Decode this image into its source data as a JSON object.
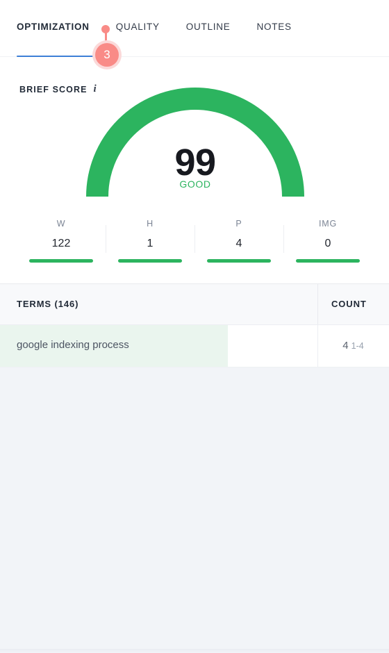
{
  "theme": {
    "accent_blue": "#3d7fd6",
    "green": "#2cb45f",
    "badge_pink": "#f98b87",
    "badge_ring": "#fbd9d9",
    "page_bg": "#f2f4f8",
    "row_highlight": "#eaf5ee"
  },
  "tabs": [
    {
      "label": "OPTIMIZATION",
      "active": true
    },
    {
      "label": "QUALITY",
      "active": false
    },
    {
      "label": "OUTLINE",
      "active": false
    },
    {
      "label": "NOTES",
      "active": false
    }
  ],
  "badge": {
    "count": "3",
    "icon": "pin-marker-icon"
  },
  "brief_score": {
    "label": "BRIEF SCORE",
    "info_icon": "i",
    "value": "99",
    "status": "GOOD"
  },
  "metrics": [
    {
      "label": "W",
      "value": "122"
    },
    {
      "label": "H",
      "value": "1"
    },
    {
      "label": "P",
      "value": "4"
    },
    {
      "label": "IMG",
      "value": "0"
    }
  ],
  "terms_table": {
    "header_terms": "TERMS (146)",
    "header_count": "COUNT",
    "rows": [
      {
        "term": "google indexing process",
        "count": "4",
        "range": "1-4"
      }
    ]
  },
  "chart_data": {
    "type": "gauge",
    "title": "BRIEF SCORE",
    "value": 99,
    "min": 0,
    "max": 100,
    "status_label": "GOOD",
    "arc_color": "#2cb45f",
    "arc_span_degrees": 180,
    "sub_metrics": {
      "type": "bar",
      "categories": [
        "W",
        "H",
        "P",
        "IMG"
      ],
      "values": [
        122,
        1,
        4,
        0
      ],
      "bar_color": "#2cb45f",
      "note": "each metric shows a full-width green progress bar"
    }
  }
}
